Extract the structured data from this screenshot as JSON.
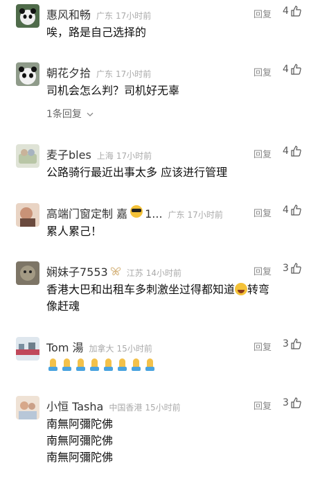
{
  "comments": [
    {
      "name": "惠风和畅",
      "location": "广东",
      "time": "17小时前",
      "reply": "回复",
      "likes": "4",
      "lines": [
        "唉，路是自己选择的"
      ],
      "avatar_color": "#3c5a3c"
    },
    {
      "name": "朝花夕拾",
      "location": "广东",
      "time": "17小时前",
      "reply": "回复",
      "likes": "4",
      "lines": [
        "司机会怎么判？司机好无辜"
      ],
      "sub_replies": "1条回复",
      "avatar_color": "#9aa"
    },
    {
      "name": "麦子bles",
      "location": "上海",
      "time": "17小时前",
      "reply": "回复",
      "likes": "4",
      "lines": [
        "公路骑行最近出事太多 应该进行管理"
      ],
      "avatar_color": "#b7c2a8"
    },
    {
      "name": "高端门窗定制 嘉",
      "name_suffix": "1...",
      "location": "广东",
      "time": "17小时前",
      "reply": "回复",
      "likes": "4",
      "lines": [
        "累人累己！"
      ],
      "avatar_color": "#c7a08a",
      "emoji": "cool-face"
    },
    {
      "name": "娴妹子7553",
      "location": "江苏",
      "time": "14小时前",
      "reply": "回复",
      "likes": "3",
      "lines_a": "香港大巴和出租车多刺激坐过得都知道",
      "lines_b": "转弯",
      "line2": "像赶魂",
      "avatar_color": "#8a7f6a",
      "badge_icon": "butterfly-icon",
      "emoji": "laughing-face"
    },
    {
      "name": "Tom 湯",
      "location": "加拿大",
      "time": "15小时前",
      "reply": "回复",
      "likes": "3",
      "pray_count": 8,
      "emoji": "praying-hands",
      "avatar_color": "#c46"
    },
    {
      "name": "小恒 Tasha",
      "location": "中国香港",
      "time": "15小时前",
      "reply": "回复",
      "likes": "3",
      "lines": [
        "南無阿彌陀佛",
        "南無阿彌陀佛",
        "南無阿彌陀佛"
      ],
      "avatar_color": "#d8b9a0"
    }
  ]
}
